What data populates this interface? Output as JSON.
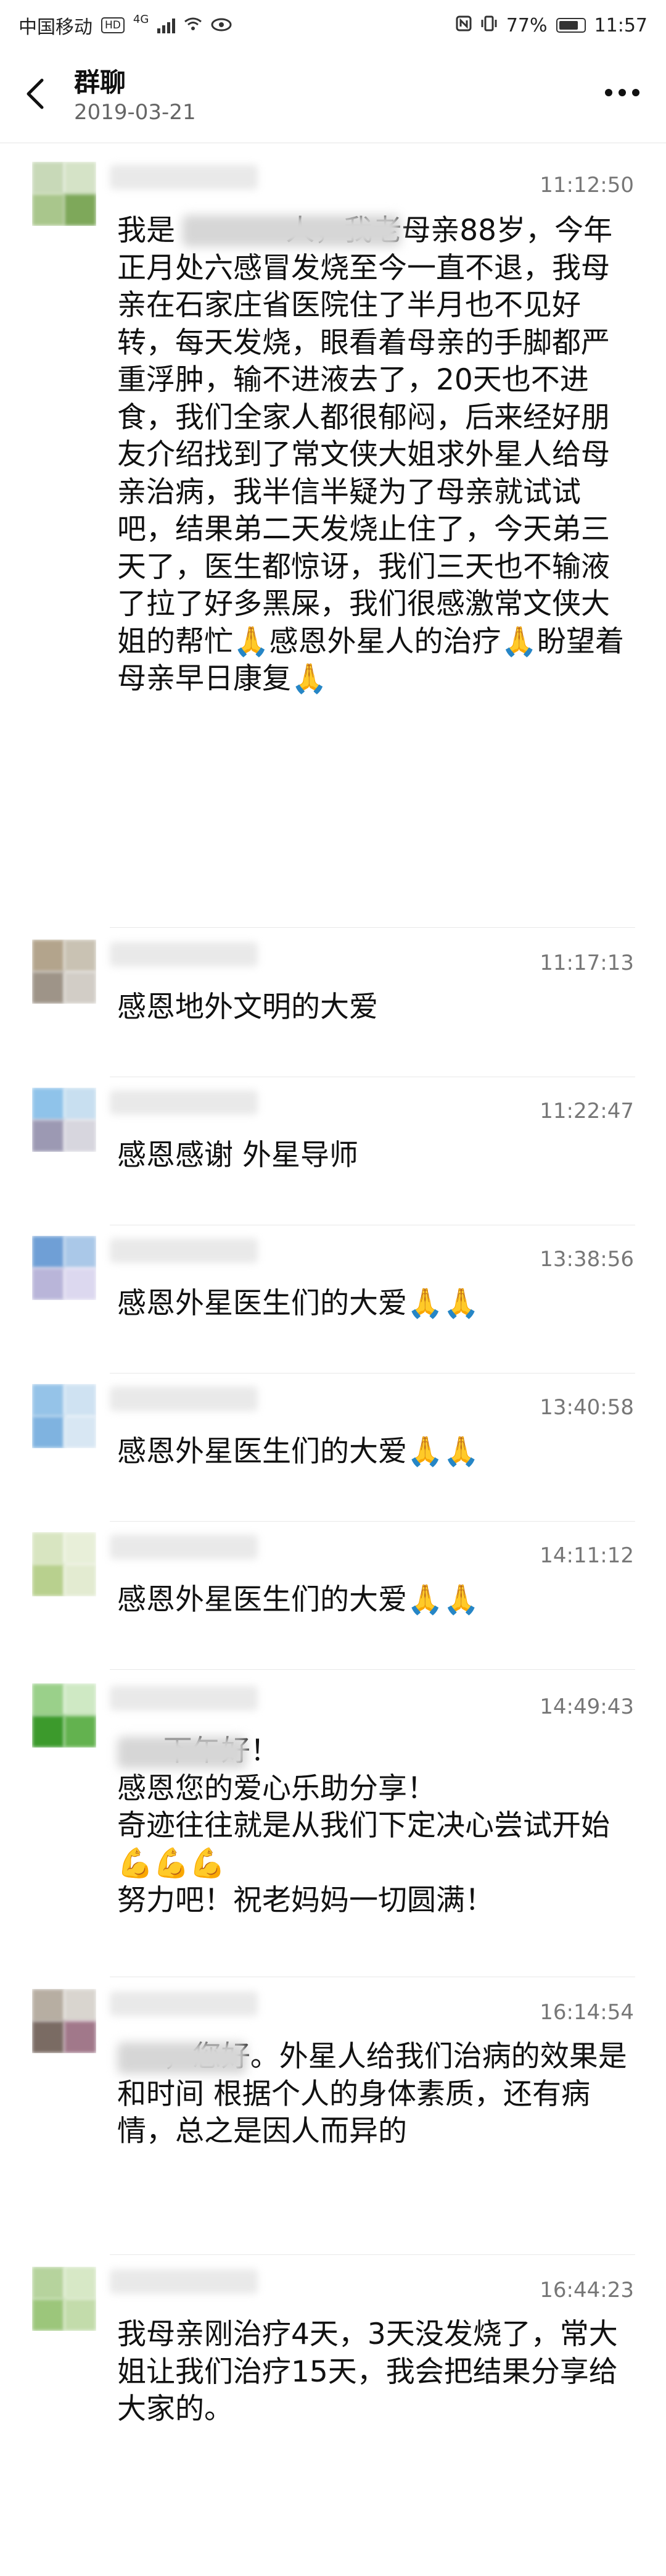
{
  "statusbar": {
    "carrier": "中国移动",
    "hd": "HD",
    "net": "4G",
    "battery": "77%",
    "time": "11:57"
  },
  "header": {
    "title": "群聊",
    "date": "2019-03-21"
  },
  "messages": [
    {
      "time": "11:12:50",
      "text": "我是            人，我老母亲88岁，今年正月处六感冒发烧至今一直不退，我母亲在石家庄省医院住了半月也不见好转，每天发烧，眼看着母亲的手脚都严重浮肿，输不进液去了，20天也不进食，我们全家人都很郁闷，后来经好朋友介绍找到了常文侠大姐求外星人给母亲治病，我半信半疑为了母亲就试试吧，结果弟二天发烧止住了，今天弟三天了，医生都惊讶，我们三天也不输液了拉了好多黑屎，我们很感激常文侠大姐的帮忙🙏感恩外星人的治疗🙏盼望着母亲早日康复🙏"
    },
    {
      "time": "11:17:13",
      "text": "感恩地外文明的大爱"
    },
    {
      "time": "11:22:47",
      "text": "感恩感谢 外星导师"
    },
    {
      "time": "13:38:56",
      "text": "感恩外星医生们的大爱🙏🙏"
    },
    {
      "time": "13:40:58",
      "text": "感恩外星医生们的大爱🙏🙏"
    },
    {
      "time": "14:11:12",
      "text": "感恩外星医生们的大爱🙏🙏"
    },
    {
      "time": "14:49:43",
      "text": "     下午好！\n感恩您的爱心乐助分享！\n奇迹往往就是从我们下定决心尝试开始💪💪💪\n努力吧！祝老妈妈一切圆满！"
    },
    {
      "time": "16:14:54",
      "text": "     ，您好。外星人给我们治病的效果是和时间 根据个人的身体素质，还有病情，总之是因人而异的"
    },
    {
      "time": "16:44:23",
      "text": "我母亲刚治疗4天，3天没发烧了，常大姐让我们治疗15天，我会把结果分享给大家的。"
    }
  ]
}
